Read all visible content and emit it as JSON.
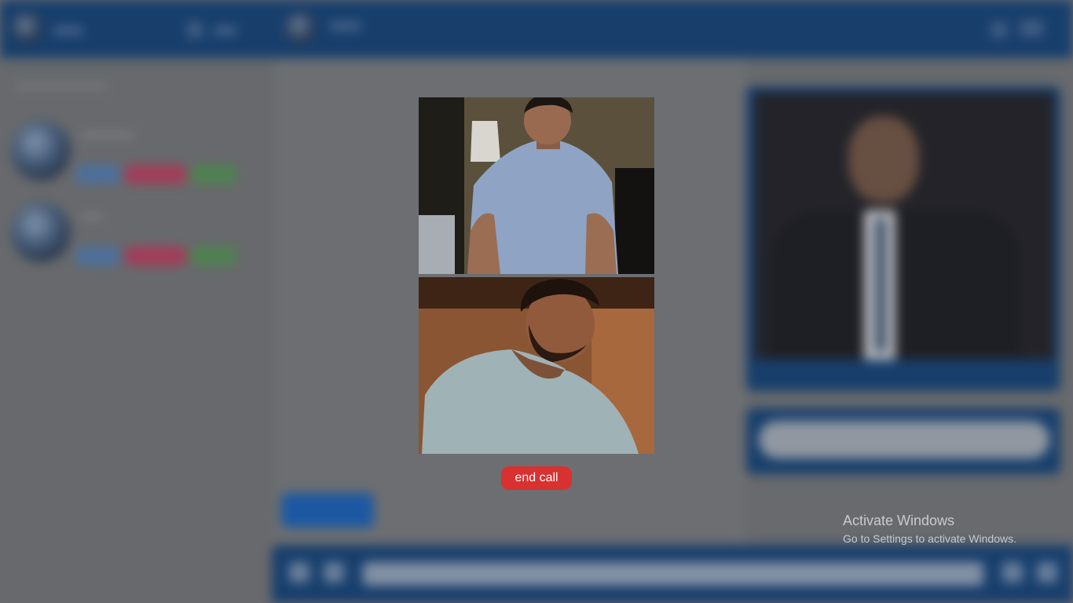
{
  "call": {
    "end_call_label": "end call"
  },
  "watermark": {
    "title": "Activate Windows",
    "subtitle": "Go to Settings to activate Windows."
  },
  "colors": {
    "topbar": "#0d3b70",
    "end_call": "#d93030",
    "pill_blue": "#4a74a8",
    "pill_red": "#b2385a",
    "pill_green": "#4d8a4e"
  }
}
